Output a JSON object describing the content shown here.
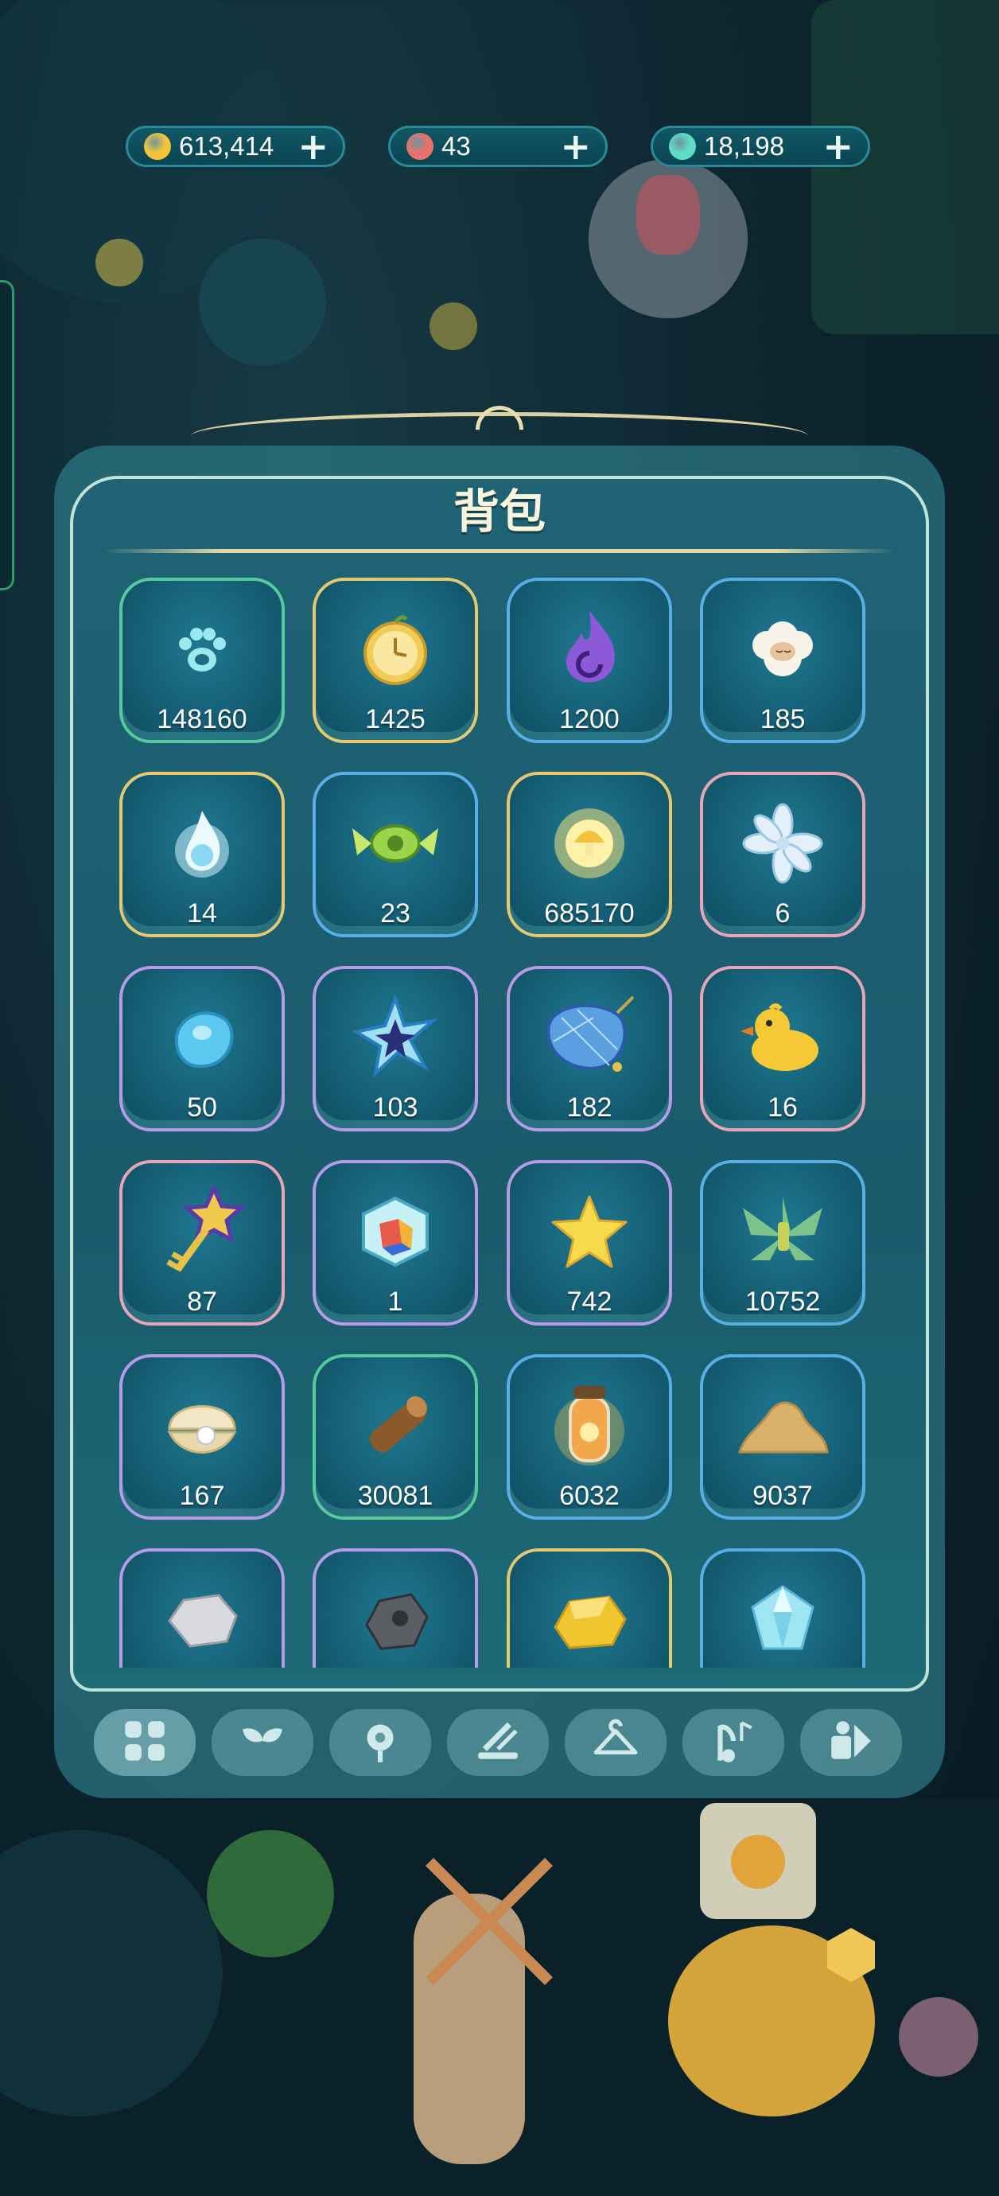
{
  "currencies": [
    {
      "name": "coins",
      "icon": "gold-coin-icon",
      "value": "613,414",
      "color": "#f3c43a"
    },
    {
      "name": "tokens",
      "icon": "red-flower-token-icon",
      "value": "43",
      "color": "#e8706a"
    },
    {
      "name": "stars",
      "icon": "teal-star-gem-icon",
      "value": "18,198",
      "color": "#5fdcc4"
    }
  ],
  "panel": {
    "title": "背包"
  },
  "items": [
    {
      "icon": "paw-print-icon",
      "count": "148160",
      "border": "green"
    },
    {
      "icon": "golden-clock-fruit-icon",
      "count": "1425",
      "border": "gold"
    },
    {
      "icon": "purple-flame-icon",
      "count": "1200",
      "border": "blue"
    },
    {
      "icon": "sheep-icon",
      "count": "185",
      "border": "blue"
    },
    {
      "icon": "blue-spirit-flame-icon",
      "count": "14",
      "border": "gold"
    },
    {
      "icon": "green-candy-icon",
      "count": "23",
      "border": "blue"
    },
    {
      "icon": "glowing-mushroom-orb-icon",
      "count": "685170",
      "border": "gold"
    },
    {
      "icon": "crystal-flower-icon",
      "count": "6",
      "border": "pink"
    },
    {
      "icon": "water-drop-slime-icon",
      "count": "50",
      "border": "purple"
    },
    {
      "icon": "blue-star-crystal-icon",
      "count": "103",
      "border": "purple"
    },
    {
      "icon": "butterfly-net-icon",
      "count": "182",
      "border": "purple"
    },
    {
      "icon": "rubber-duck-icon",
      "count": "16",
      "border": "pink"
    },
    {
      "icon": "star-key-icon",
      "count": "87",
      "border": "pink"
    },
    {
      "icon": "prism-cube-icon",
      "count": "1",
      "border": "purple"
    },
    {
      "icon": "yellow-star-icon",
      "count": "742",
      "border": "purple"
    },
    {
      "icon": "grass-bundle-icon",
      "count": "10752",
      "border": "blue"
    },
    {
      "icon": "pearl-shell-icon",
      "count": "167",
      "border": "purple"
    },
    {
      "icon": "wood-log-icon",
      "count": "30081",
      "border": "green"
    },
    {
      "icon": "firefly-jar-icon",
      "count": "6032",
      "border": "blue"
    },
    {
      "icon": "sand-pile-icon",
      "count": "9037",
      "border": "blue"
    },
    {
      "icon": "gray-stone-icon",
      "count": "",
      "border": "purple"
    },
    {
      "icon": "iron-ore-icon",
      "count": "",
      "border": "purple"
    },
    {
      "icon": "gold-nugget-icon",
      "count": "",
      "border": "gold"
    },
    {
      "icon": "diamond-gem-icon",
      "count": "",
      "border": "blue"
    }
  ],
  "tabs": [
    {
      "icon": "grid-all-icon",
      "active": true
    },
    {
      "icon": "sprout-icon",
      "active": false
    },
    {
      "icon": "flower-lantern-icon",
      "active": false
    },
    {
      "icon": "tools-icon",
      "active": false
    },
    {
      "icon": "hanger-icon",
      "active": false
    },
    {
      "icon": "music-note-icon",
      "active": false
    },
    {
      "icon": "puzzle-misc-icon",
      "active": false
    }
  ]
}
